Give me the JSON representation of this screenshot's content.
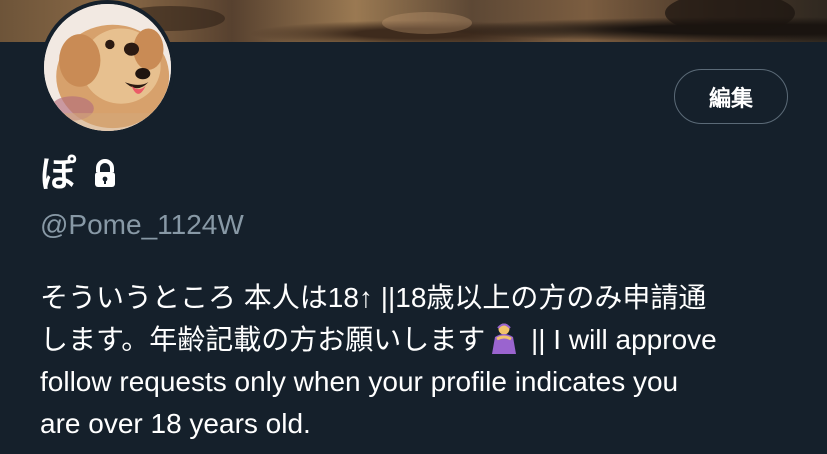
{
  "profile": {
    "display_name": "ぽ",
    "handle": "@Pome_1124W",
    "edit_label": "編集",
    "bio": {
      "line1": "そういうところ 本人は18↑ ||18歳以上の方のみ申請通",
      "line2_before_emoji": "します。年齢記載の方お願いします",
      "line2_after_emoji": " || I will approve",
      "line3": "follow requests only when your profile indicates you",
      "line4": "are over 18 years old."
    },
    "icons": {
      "avatar": "pomeranian-avatar",
      "lock": "lock-icon",
      "emoji": "person-bowing-emoji-icon"
    }
  },
  "colors": {
    "background": "#15202b",
    "secondary_text": "#8899a6",
    "button_border": "#5b6a77",
    "primary_text": "#ffffff"
  }
}
